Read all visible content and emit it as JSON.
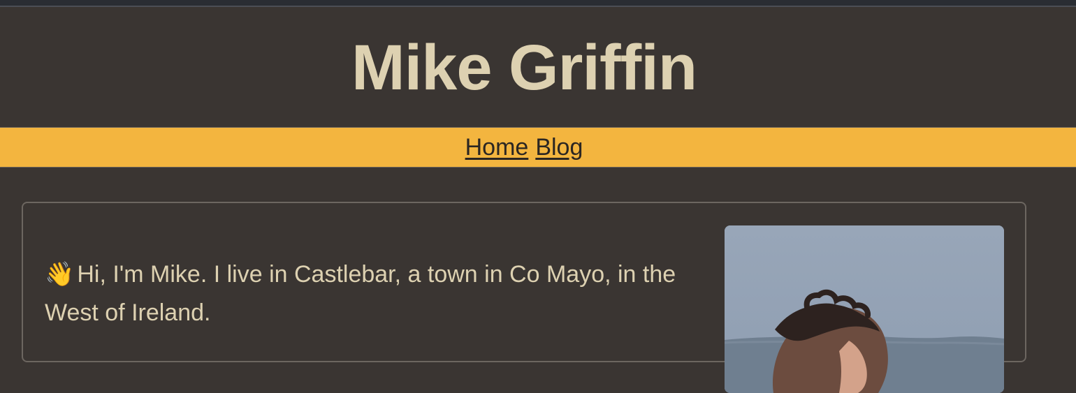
{
  "header": {
    "title": "Mike Griffin"
  },
  "nav": {
    "items": [
      {
        "label": "Home"
      },
      {
        "label": "Blog"
      }
    ]
  },
  "intro": {
    "emoji": "👋",
    "text": "Hi, I'm Mike. I live in Castlebar, a town in Co Mayo, in the West of Ireland."
  },
  "colors": {
    "background": "#3a3532",
    "title": "#ddd1b1",
    "nav_background": "#f3b53f",
    "nav_link": "#2b2622",
    "card_border": "#6c6660"
  }
}
